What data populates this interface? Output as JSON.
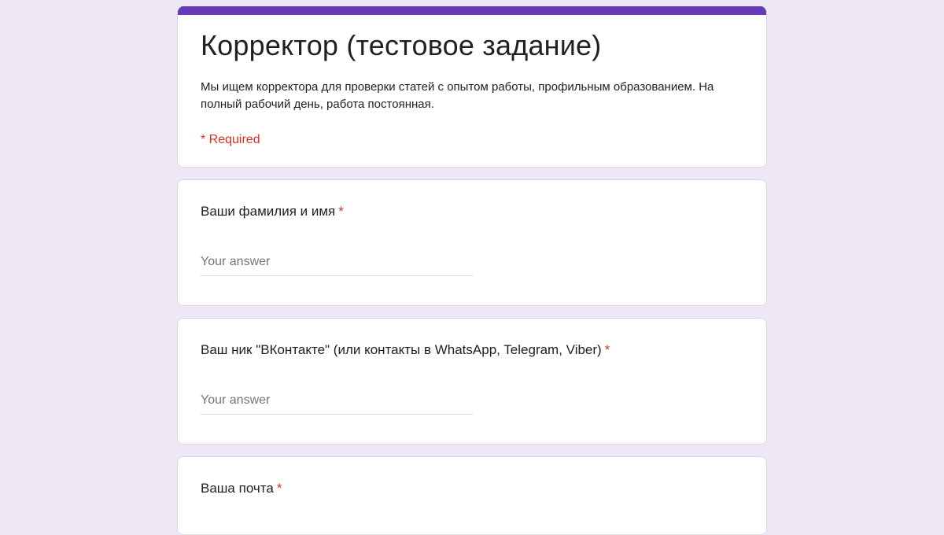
{
  "form": {
    "title": "Корректор (тестовое задание)",
    "description": "Мы ищем корректора для проверки статей с опытом работы, профильным образованием. На полный рабочий день, работа постоянная.",
    "required_note": "* Required",
    "accent_color": "#673ab7",
    "background_color": "#ede7f6",
    "required_color": "#d93025"
  },
  "questions": [
    {
      "label": "Ваши фамилия и имя",
      "required_mark": "*",
      "placeholder": "Your answer"
    },
    {
      "label": "Ваш ник \"ВКонтакте\" (или контакты в WhatsApp, Telegram, Viber)",
      "required_mark": "*",
      "placeholder": "Your answer"
    },
    {
      "label": "Ваша почта",
      "required_mark": "*"
    }
  ]
}
